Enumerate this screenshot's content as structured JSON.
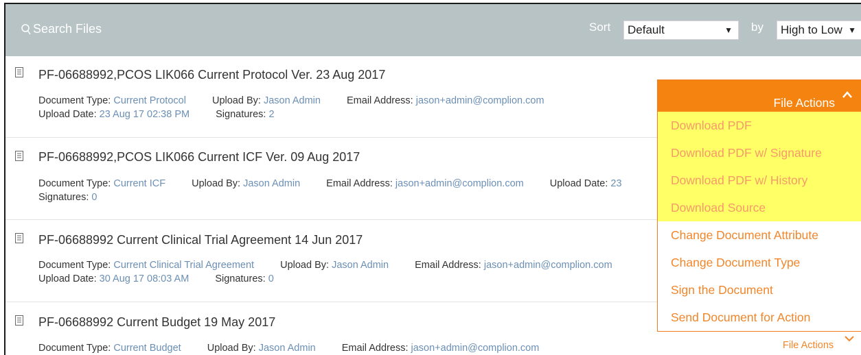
{
  "search": {
    "placeholder": "Search Files"
  },
  "sort": {
    "label": "Sort",
    "selected": "Default",
    "by_label": "by",
    "order": "High to Low"
  },
  "documents": [
    {
      "title": "PF-06688992,PCOS LIK066 Current Protocol Ver. 23 Aug 2017",
      "doc_type_label": "Document Type:",
      "doc_type": "Current Protocol",
      "upload_by_label": "Upload By:",
      "upload_by": "Jason Admin",
      "email_label": "Email Address:",
      "email": "jason+admin@complion.com",
      "upload_date_label": "Upload Date:",
      "upload_date": "23 Aug 17 02:38 PM",
      "signatures_label": "Signatures:",
      "signatures": "2"
    },
    {
      "title": "PF-06688992,PCOS LIK066 Current ICF Ver. 09 Aug 2017",
      "doc_type_label": "Document Type:",
      "doc_type": "Current ICF",
      "upload_by_label": "Upload By:",
      "upload_by": "Jason Admin",
      "email_label": "Email Address:",
      "email": "jason+admin@complion.com",
      "upload_date_label": "Upload Date:",
      "upload_date": "23",
      "signatures_label": "Signatures:",
      "signatures": "0"
    },
    {
      "title": "PF-06688992 Current Clinical Trial Agreement 14 Jun 2017",
      "doc_type_label": "Document Type:",
      "doc_type": "Current Clinical Trial Agreement",
      "upload_by_label": "Upload By:",
      "upload_by": "Jason Admin",
      "email_label": "Email Address:",
      "email": "jason+admin@complion.com",
      "upload_date_label": "Upload Date:",
      "upload_date": "30 Aug 17 08:03 AM",
      "signatures_label": "Signatures:",
      "signatures": "0"
    },
    {
      "title": "PF-06688992 Current Budget 19 May 2017",
      "doc_type_label": "Document Type:",
      "doc_type": "Current Budget",
      "upload_by_label": "Upload By:",
      "upload_by": "Jason Admin",
      "email_label": "Email Address:",
      "email": "jason+admin@complion.com"
    }
  ],
  "file_actions": {
    "header": "File Actions",
    "items": [
      "Download PDF",
      "Download PDF w/ Signature",
      "Download PDF w/ History",
      "Download Source",
      "Change Document Attribute",
      "Change Document Type",
      "Sign the Document",
      "Send Document for Action"
    ],
    "bottom_label": "File Actions"
  },
  "colors": {
    "topbar": "#b8c3c6",
    "accent_orange": "#f5830f",
    "highlight_yellow": "#ffff66",
    "link_blue": "#6b8fb5"
  },
  "icons": [
    "search-icon",
    "document-icon",
    "chevron-up-icon",
    "chevron-down-icon"
  ]
}
